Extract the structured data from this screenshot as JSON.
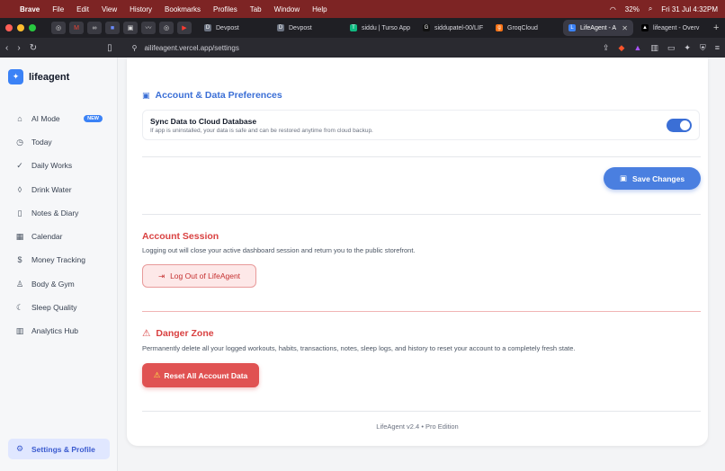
{
  "menubar": {
    "app": "Brave",
    "items": [
      "File",
      "Edit",
      "View",
      "History",
      "Bookmarks",
      "Profiles",
      "Tab",
      "Window",
      "Help"
    ],
    "battery": "32%",
    "datetime": "Fri 31 Jul  4:32PM"
  },
  "tabs": [
    {
      "label": "Devpost",
      "icon": "D"
    },
    {
      "label": "Devpost",
      "icon": "D"
    },
    {
      "label": "siddu | Turso App",
      "icon": "T"
    },
    {
      "label": "siddupatel-00/LIF",
      "icon": "G"
    },
    {
      "label": "GroqCloud",
      "icon": "g"
    },
    {
      "label": "LifeAgent - A",
      "icon": "L"
    },
    {
      "label": "lifeagent - Overv",
      "icon": "▲"
    }
  ],
  "url": "ailifeagent.vercel.app/settings",
  "brand": {
    "name": "lifeagent",
    "accent": "#3b82f6"
  },
  "sidebar": {
    "items": [
      {
        "label": "AI Mode",
        "icon": "robot-icon",
        "badge": "NEW"
      },
      {
        "label": "Today",
        "icon": "clock-icon"
      },
      {
        "label": "Daily Works",
        "icon": "check-circle-icon"
      },
      {
        "label": "Drink Water",
        "icon": "droplet-icon"
      },
      {
        "label": "Notes & Diary",
        "icon": "book-icon"
      },
      {
        "label": "Calendar",
        "icon": "calendar-icon"
      },
      {
        "label": "Money Tracking",
        "icon": "dollar-icon"
      },
      {
        "label": "Body & Gym",
        "icon": "dumbbell-icon"
      },
      {
        "label": "Sleep Quality",
        "icon": "moon-icon"
      },
      {
        "label": "Analytics Hub",
        "icon": "chart-icon"
      }
    ],
    "settings_label": "Settings & Profile"
  },
  "prefs": {
    "title": "Account & Data Preferences",
    "sync_title": "Sync Data to Cloud Database",
    "sync_desc": "If app is uninstalled, your data is safe and can be restored anytime from cloud backup.",
    "sync_enabled": true,
    "save_label": "Save Changes"
  },
  "session": {
    "title": "Account Session",
    "desc": "Logging out will close your active dashboard session and return you to the public storefront.",
    "logout_label": "Log Out of LifeAgent"
  },
  "danger": {
    "title": "Danger Zone",
    "desc": "Permanently delete all your logged workouts, habits, transactions, notes, sleep logs, and history to reset your account to a completely fresh state.",
    "reset_label": "Reset All Account Data"
  },
  "footer": "LifeAgent v2.4 • Pro Edition"
}
